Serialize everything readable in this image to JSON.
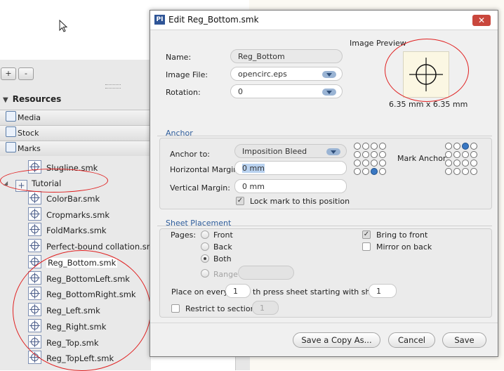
{
  "left_panel": {
    "add_btn": "+",
    "remove_btn": "-",
    "resources_title": "Resources",
    "categories": [
      "Media",
      "Stock",
      "Marks"
    ],
    "tree": {
      "slugline": "Slugline.smk",
      "tutorial_folder": "Tutorial",
      "items": [
        "ColorBar.smk",
        "Cropmarks.smk",
        "FoldMarks.smk",
        "Perfect-bound collation.smk",
        "Reg_Bottom.smk",
        "Reg_BottomLeft.smk",
        "Reg_BottomRight.smk",
        "Reg_Left.smk",
        "Reg_Right.smk",
        "Reg_Top.smk",
        "Reg_TopLeft.smk"
      ]
    }
  },
  "dialog": {
    "app_icon": "PI",
    "title": "Edit Reg_Bottom.smk",
    "close": "✕",
    "name_label": "Name:",
    "name_value": "Reg_Bottom",
    "image_file_label": "Image File:",
    "image_file_value": "opencirc.eps",
    "rotation_label": "Rotation:",
    "rotation_value": "0",
    "image_preview_label": "Image Preview",
    "preview_size": "6.35 mm x 6.35 mm",
    "anchor_section": "Anchor",
    "anchor_to_label": "Anchor to:",
    "anchor_to_value": "Imposition Bleed",
    "mark_anchor_label": "Mark Anchor:",
    "horizontal_margin_label": "Horizontal Margin:",
    "horizontal_margin_value": "0 mm",
    "vertical_margin_label": "Vertical Margin:",
    "vertical_margin_value": "0 mm",
    "lock_label": "Lock mark to this position",
    "sheet_section": "Sheet Placement",
    "pages_label": "Pages:",
    "pages_front": "Front",
    "pages_back": "Back",
    "pages_both": "Both",
    "pages_range": "Range",
    "bring_to_front": "Bring to front",
    "mirror_on_back": "Mirror on back",
    "place_every_prefix": "Place on every",
    "place_every_value": "1",
    "place_every_suffix": "th press sheet starting with sheet",
    "starting_sheet_value": "1",
    "restrict_label": "Restrict to section:",
    "restrict_value": "1",
    "save_copy_btn": "Save a Copy As...",
    "cancel_btn": "Cancel",
    "save_btn": "Save"
  },
  "colors": {
    "accent": "#2e5d9c",
    "annotation": "#e02020",
    "anchor_selected": "#3a78c3"
  }
}
